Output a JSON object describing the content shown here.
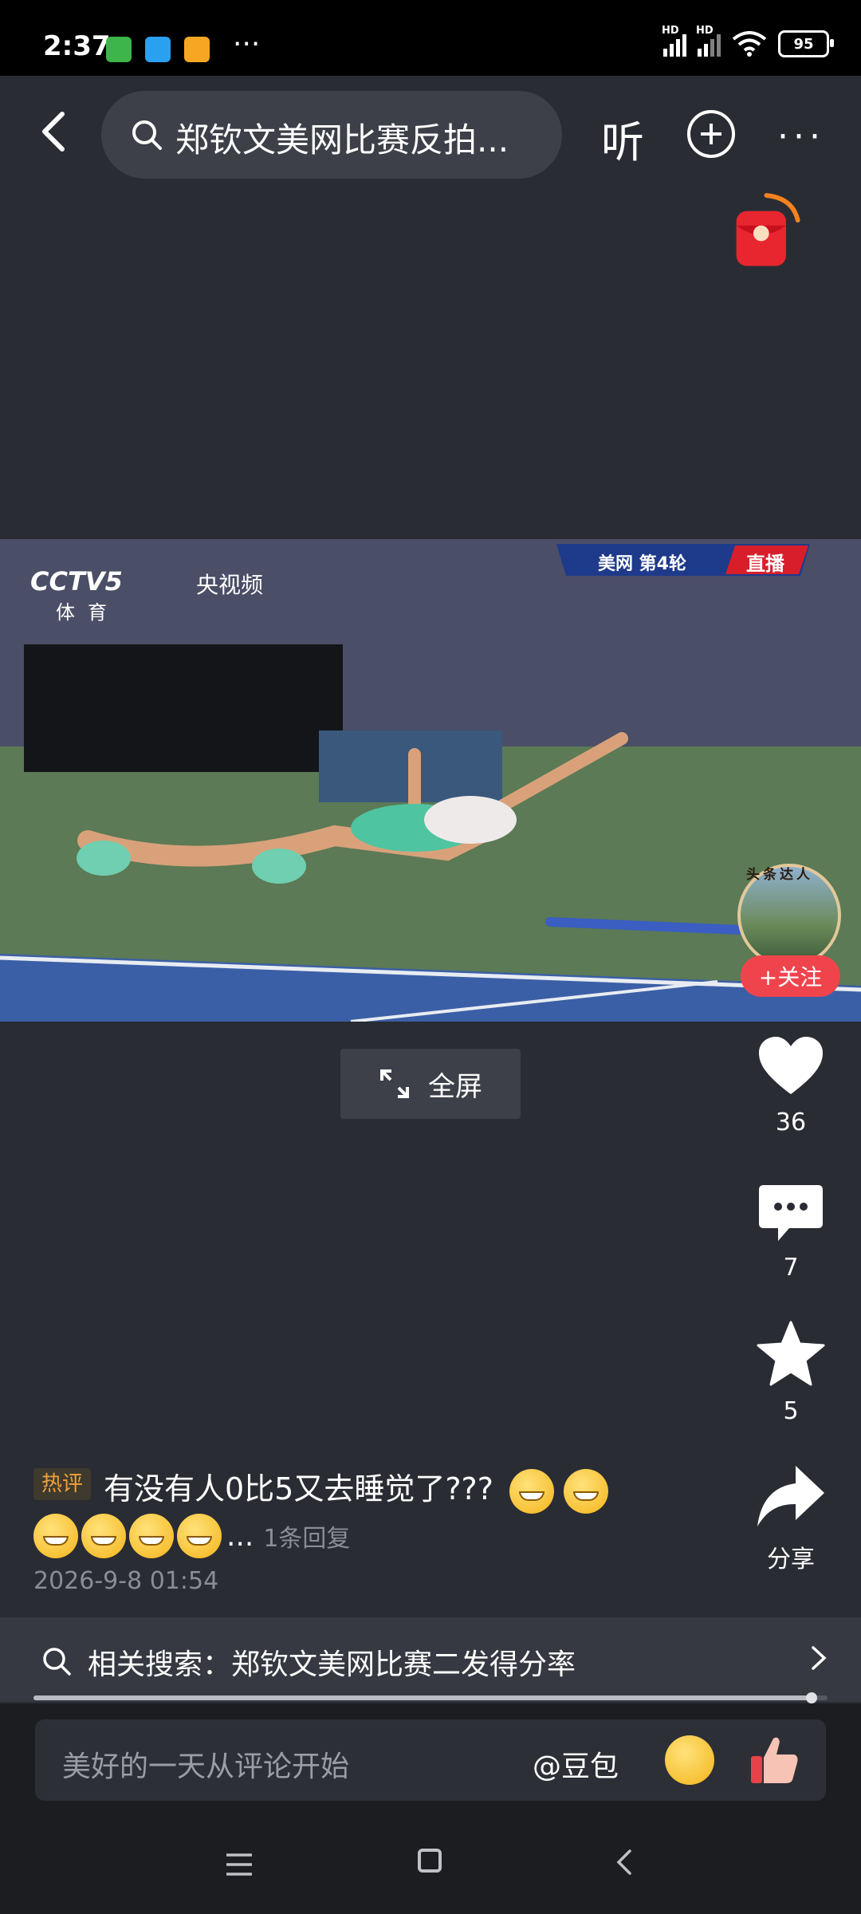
{
  "status_bar": {
    "time": "2:37",
    "dots": "···",
    "signal1_label": "HD",
    "signal2_label": "HD",
    "battery": "95"
  },
  "top_bar": {
    "search_text": "郑钦文美网比赛反拍...",
    "listen_label": "听"
  },
  "video": {
    "channel_logo": "CCTV5",
    "channel_sub": "体育",
    "platform": "央视频",
    "banner_text": "美网  第4轮",
    "banner_live": "直播",
    "avatar_tag": "头条达人",
    "follow_label": "+关注"
  },
  "fullscreen_label": "全屏",
  "actions": {
    "likes": "36",
    "comments": "7",
    "favorites": "5",
    "share_label": "分享"
  },
  "hot_comment": {
    "tag": "热评",
    "text": "有没有人0比5又去睡觉了???",
    "ellipsis": "...",
    "reply_count": "1条回复",
    "time": "2026-9-8 01:54"
  },
  "related_search": {
    "text": "相关搜索：郑钦文美网比赛二发得分率"
  },
  "progress": {
    "fraction": 0.98
  },
  "bottom_bar": {
    "placeholder": "美好的一天从评论开始",
    "mention": "@豆包"
  },
  "colors": {
    "accent_red": "#f0444d",
    "hot_tag": "#f2a13a",
    "background": "#2a2c33"
  }
}
